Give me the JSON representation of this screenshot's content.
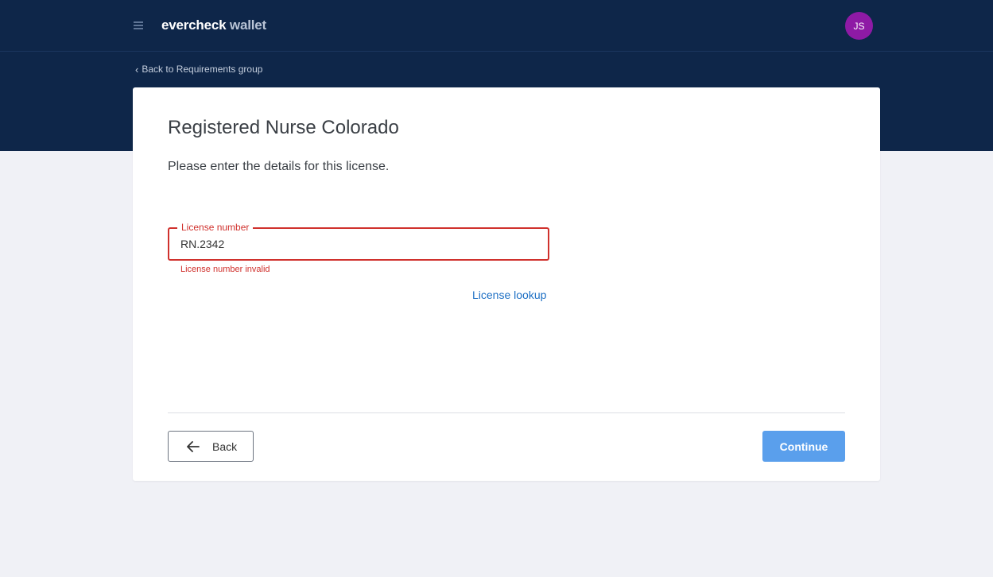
{
  "header": {
    "logo_primary": "evercheck",
    "logo_secondary": "wallet",
    "avatar_initials": "JS",
    "background_color": "#0e2649",
    "avatar_color": "#8e1aa5"
  },
  "breadcrumb": {
    "label": "Back to Requirements group",
    "icon": "chevron-left-icon"
  },
  "card": {
    "title": "Registered Nurse Colorado",
    "subtitle": "Please enter the details for this license.",
    "license_field": {
      "label": "License number",
      "value": "RN.2342",
      "error": "License number invalid",
      "error_color": "#d0312d"
    },
    "lookup_link": "License lookup",
    "back_button": "Back",
    "continue_button": "Continue",
    "continue_color": "#5a9fec"
  }
}
